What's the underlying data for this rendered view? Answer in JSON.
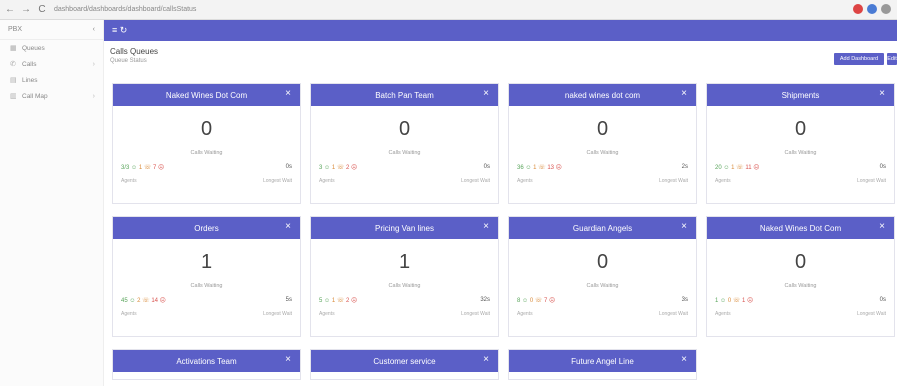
{
  "browser": {
    "back": "←",
    "forward": "→",
    "reload": "C",
    "url": "dashboard/dashboards/dashboard/callsStatus"
  },
  "sidebar": {
    "header": "PBX",
    "items": [
      {
        "icon": "▦",
        "label": "Queues"
      },
      {
        "icon": "✆",
        "label": "Calls"
      },
      {
        "icon": "▤",
        "label": "Lines"
      },
      {
        "icon": "▥",
        "label": "Call Map"
      }
    ]
  },
  "topbar": {
    "label": "≡ ↻"
  },
  "page": {
    "title": "Calls Queues",
    "subtitle": "Queue Status"
  },
  "actions": {
    "primary": "Add Dashboard",
    "secondary": "Edit"
  },
  "cards": [
    {
      "title": "Naked Wines Dot Com",
      "count": "0",
      "state": "Calls Waiting",
      "stats": [
        "3/3 ☺",
        "1 ☏",
        "7 ☹"
      ],
      "right": "0s",
      "agents": "Agents",
      "longest": "Longest Wait"
    },
    {
      "title": "Batch Pan Team",
      "count": "0",
      "state": "Calls Waiting",
      "stats": [
        "3 ☺",
        "1 ☏",
        "2 ☹"
      ],
      "right": "0s",
      "agents": "Agents",
      "longest": "Longest Wait"
    },
    {
      "title": "naked wines dot com",
      "count": "0",
      "state": "Calls Waiting",
      "stats": [
        "36 ☺",
        "1 ☏",
        "13 ☹"
      ],
      "right": "2s",
      "agents": "Agents",
      "longest": "Longest Wait"
    },
    {
      "title": "Shipments",
      "count": "0",
      "state": "Calls Waiting",
      "stats": [
        "20 ☺",
        "1 ☏",
        "11 ☹"
      ],
      "right": "0s",
      "agents": "Agents",
      "longest": "Longest Wait"
    },
    {
      "title": "Orders",
      "count": "1",
      "state": "Calls Waiting",
      "stats": [
        "45 ☺",
        "2 ☏",
        "14 ☹"
      ],
      "right": "5s",
      "agents": "Agents",
      "longest": "Longest Wait"
    },
    {
      "title": "Pricing Van lines",
      "count": "1",
      "state": "Calls Waiting",
      "stats": [
        "5 ☺",
        "1 ☏",
        "2 ☹"
      ],
      "right": "32s",
      "agents": "Agents",
      "longest": "Longest Wait"
    },
    {
      "title": "Guardian Angels",
      "count": "0",
      "state": "Calls Waiting",
      "stats": [
        "8 ☺",
        "0 ☏",
        "7 ☹"
      ],
      "right": "3s",
      "agents": "Agents",
      "longest": "Longest Wait"
    },
    {
      "title": "Naked Wines Dot Com",
      "count": "0",
      "state": "Calls Waiting",
      "stats": [
        "1 ☺",
        "0 ☏",
        "1 ☹"
      ],
      "right": "0s",
      "agents": "Agents",
      "longest": "Longest Wait"
    },
    {
      "title": "Activations Team",
      "count": "",
      "state": "",
      "stats": [
        "",
        "",
        ""
      ],
      "right": "",
      "agents": "",
      "longest": ""
    },
    {
      "title": "Customer service",
      "count": "",
      "state": "",
      "stats": [
        "",
        "",
        ""
      ],
      "right": "",
      "agents": "",
      "longest": ""
    },
    {
      "title": "Future Angel Line",
      "count": "",
      "state": "",
      "stats": [
        "",
        "",
        ""
      ],
      "right": "",
      "agents": "",
      "longest": ""
    }
  ],
  "colors": {
    "accent": "#5b5fc7"
  }
}
